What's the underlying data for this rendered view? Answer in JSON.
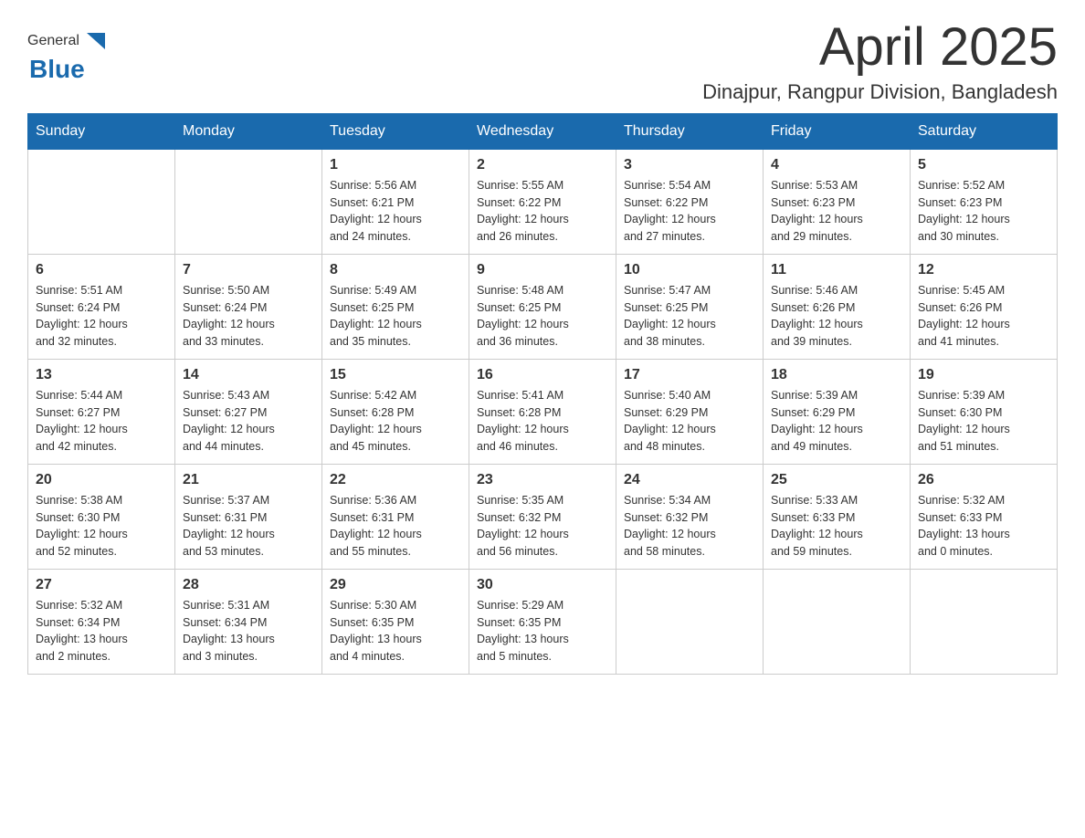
{
  "header": {
    "month_year": "April 2025",
    "location": "Dinajpur, Rangpur Division, Bangladesh",
    "logo_general": "General",
    "logo_blue": "Blue"
  },
  "weekdays": [
    "Sunday",
    "Monday",
    "Tuesday",
    "Wednesday",
    "Thursday",
    "Friday",
    "Saturday"
  ],
  "weeks": [
    [
      {
        "day": "",
        "sunrise": "",
        "sunset": "",
        "daylight": ""
      },
      {
        "day": "",
        "sunrise": "",
        "sunset": "",
        "daylight": ""
      },
      {
        "day": "1",
        "sunrise": "Sunrise: 5:56 AM",
        "sunset": "Sunset: 6:21 PM",
        "daylight": "Daylight: 12 hours and 24 minutes."
      },
      {
        "day": "2",
        "sunrise": "Sunrise: 5:55 AM",
        "sunset": "Sunset: 6:22 PM",
        "daylight": "Daylight: 12 hours and 26 minutes."
      },
      {
        "day": "3",
        "sunrise": "Sunrise: 5:54 AM",
        "sunset": "Sunset: 6:22 PM",
        "daylight": "Daylight: 12 hours and 27 minutes."
      },
      {
        "day": "4",
        "sunrise": "Sunrise: 5:53 AM",
        "sunset": "Sunset: 6:23 PM",
        "daylight": "Daylight: 12 hours and 29 minutes."
      },
      {
        "day": "5",
        "sunrise": "Sunrise: 5:52 AM",
        "sunset": "Sunset: 6:23 PM",
        "daylight": "Daylight: 12 hours and 30 minutes."
      }
    ],
    [
      {
        "day": "6",
        "sunrise": "Sunrise: 5:51 AM",
        "sunset": "Sunset: 6:24 PM",
        "daylight": "Daylight: 12 hours and 32 minutes."
      },
      {
        "day": "7",
        "sunrise": "Sunrise: 5:50 AM",
        "sunset": "Sunset: 6:24 PM",
        "daylight": "Daylight: 12 hours and 33 minutes."
      },
      {
        "day": "8",
        "sunrise": "Sunrise: 5:49 AM",
        "sunset": "Sunset: 6:25 PM",
        "daylight": "Daylight: 12 hours and 35 minutes."
      },
      {
        "day": "9",
        "sunrise": "Sunrise: 5:48 AM",
        "sunset": "Sunset: 6:25 PM",
        "daylight": "Daylight: 12 hours and 36 minutes."
      },
      {
        "day": "10",
        "sunrise": "Sunrise: 5:47 AM",
        "sunset": "Sunset: 6:25 PM",
        "daylight": "Daylight: 12 hours and 38 minutes."
      },
      {
        "day": "11",
        "sunrise": "Sunrise: 5:46 AM",
        "sunset": "Sunset: 6:26 PM",
        "daylight": "Daylight: 12 hours and 39 minutes."
      },
      {
        "day": "12",
        "sunrise": "Sunrise: 5:45 AM",
        "sunset": "Sunset: 6:26 PM",
        "daylight": "Daylight: 12 hours and 41 minutes."
      }
    ],
    [
      {
        "day": "13",
        "sunrise": "Sunrise: 5:44 AM",
        "sunset": "Sunset: 6:27 PM",
        "daylight": "Daylight: 12 hours and 42 minutes."
      },
      {
        "day": "14",
        "sunrise": "Sunrise: 5:43 AM",
        "sunset": "Sunset: 6:27 PM",
        "daylight": "Daylight: 12 hours and 44 minutes."
      },
      {
        "day": "15",
        "sunrise": "Sunrise: 5:42 AM",
        "sunset": "Sunset: 6:28 PM",
        "daylight": "Daylight: 12 hours and 45 minutes."
      },
      {
        "day": "16",
        "sunrise": "Sunrise: 5:41 AM",
        "sunset": "Sunset: 6:28 PM",
        "daylight": "Daylight: 12 hours and 46 minutes."
      },
      {
        "day": "17",
        "sunrise": "Sunrise: 5:40 AM",
        "sunset": "Sunset: 6:29 PM",
        "daylight": "Daylight: 12 hours and 48 minutes."
      },
      {
        "day": "18",
        "sunrise": "Sunrise: 5:39 AM",
        "sunset": "Sunset: 6:29 PM",
        "daylight": "Daylight: 12 hours and 49 minutes."
      },
      {
        "day": "19",
        "sunrise": "Sunrise: 5:39 AM",
        "sunset": "Sunset: 6:30 PM",
        "daylight": "Daylight: 12 hours and 51 minutes."
      }
    ],
    [
      {
        "day": "20",
        "sunrise": "Sunrise: 5:38 AM",
        "sunset": "Sunset: 6:30 PM",
        "daylight": "Daylight: 12 hours and 52 minutes."
      },
      {
        "day": "21",
        "sunrise": "Sunrise: 5:37 AM",
        "sunset": "Sunset: 6:31 PM",
        "daylight": "Daylight: 12 hours and 53 minutes."
      },
      {
        "day": "22",
        "sunrise": "Sunrise: 5:36 AM",
        "sunset": "Sunset: 6:31 PM",
        "daylight": "Daylight: 12 hours and 55 minutes."
      },
      {
        "day": "23",
        "sunrise": "Sunrise: 5:35 AM",
        "sunset": "Sunset: 6:32 PM",
        "daylight": "Daylight: 12 hours and 56 minutes."
      },
      {
        "day": "24",
        "sunrise": "Sunrise: 5:34 AM",
        "sunset": "Sunset: 6:32 PM",
        "daylight": "Daylight: 12 hours and 58 minutes."
      },
      {
        "day": "25",
        "sunrise": "Sunrise: 5:33 AM",
        "sunset": "Sunset: 6:33 PM",
        "daylight": "Daylight: 12 hours and 59 minutes."
      },
      {
        "day": "26",
        "sunrise": "Sunrise: 5:32 AM",
        "sunset": "Sunset: 6:33 PM",
        "daylight": "Daylight: 13 hours and 0 minutes."
      }
    ],
    [
      {
        "day": "27",
        "sunrise": "Sunrise: 5:32 AM",
        "sunset": "Sunset: 6:34 PM",
        "daylight": "Daylight: 13 hours and 2 minutes."
      },
      {
        "day": "28",
        "sunrise": "Sunrise: 5:31 AM",
        "sunset": "Sunset: 6:34 PM",
        "daylight": "Daylight: 13 hours and 3 minutes."
      },
      {
        "day": "29",
        "sunrise": "Sunrise: 5:30 AM",
        "sunset": "Sunset: 6:35 PM",
        "daylight": "Daylight: 13 hours and 4 minutes."
      },
      {
        "day": "30",
        "sunrise": "Sunrise: 5:29 AM",
        "sunset": "Sunset: 6:35 PM",
        "daylight": "Daylight: 13 hours and 5 minutes."
      },
      {
        "day": "",
        "sunrise": "",
        "sunset": "",
        "daylight": ""
      },
      {
        "day": "",
        "sunrise": "",
        "sunset": "",
        "daylight": ""
      },
      {
        "day": "",
        "sunrise": "",
        "sunset": "",
        "daylight": ""
      }
    ]
  ]
}
